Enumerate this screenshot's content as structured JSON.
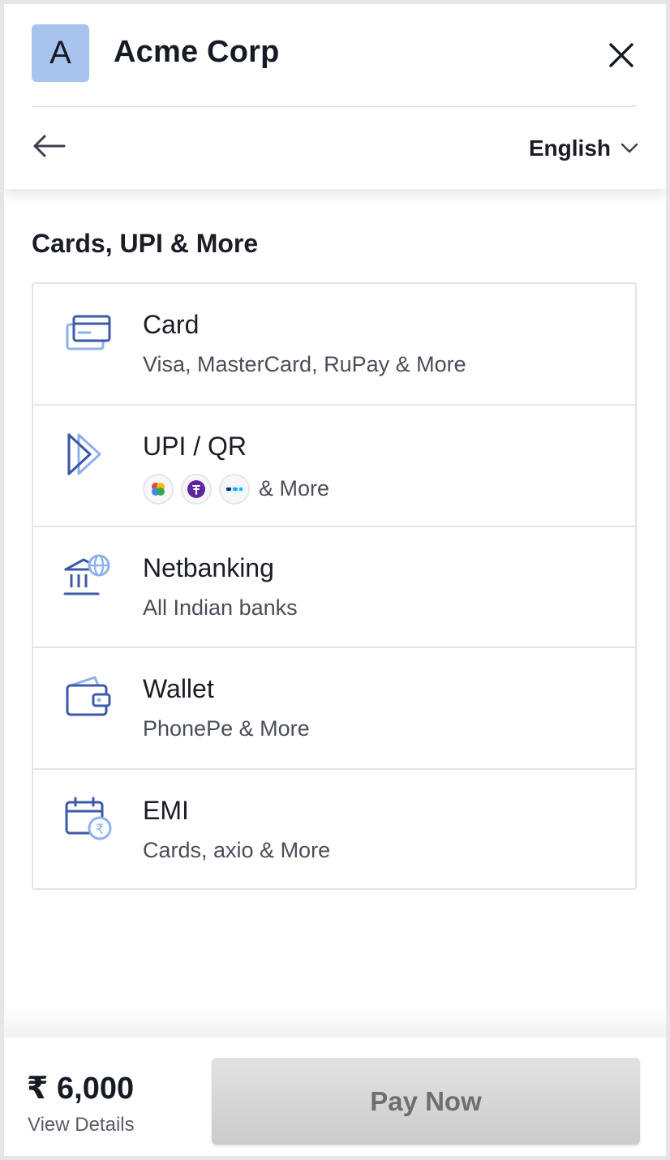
{
  "header": {
    "logo_letter": "A",
    "merchant_name": "Acme Corp",
    "language": "English"
  },
  "section": {
    "title": "Cards, UPI & More"
  },
  "methods": [
    {
      "title": "Card",
      "subtitle": "Visa, MasterCard, RuPay & More",
      "icon": "credit-card-icon"
    },
    {
      "title": "UPI / QR",
      "subtitle": "& More",
      "icon": "upi-icon",
      "apps": [
        "google-pay-icon",
        "phonepe-icon",
        "paytm-icon"
      ]
    },
    {
      "title": "Netbanking",
      "subtitle": "All Indian banks",
      "icon": "bank-icon"
    },
    {
      "title": "Wallet",
      "subtitle": "PhonePe & More",
      "icon": "wallet-icon"
    },
    {
      "title": "EMI",
      "subtitle": "Cards, axio & More",
      "icon": "emi-calendar-icon"
    }
  ],
  "footer": {
    "amount": "₹ 6,000",
    "view_details": "View Details",
    "pay_button": "Pay Now"
  },
  "colors": {
    "accent_blue": "#3d5aa8",
    "accent_light": "#8fb1ea",
    "logo_bg": "#a9c3ef",
    "pay_button_disabled": "#d4d4d4"
  }
}
